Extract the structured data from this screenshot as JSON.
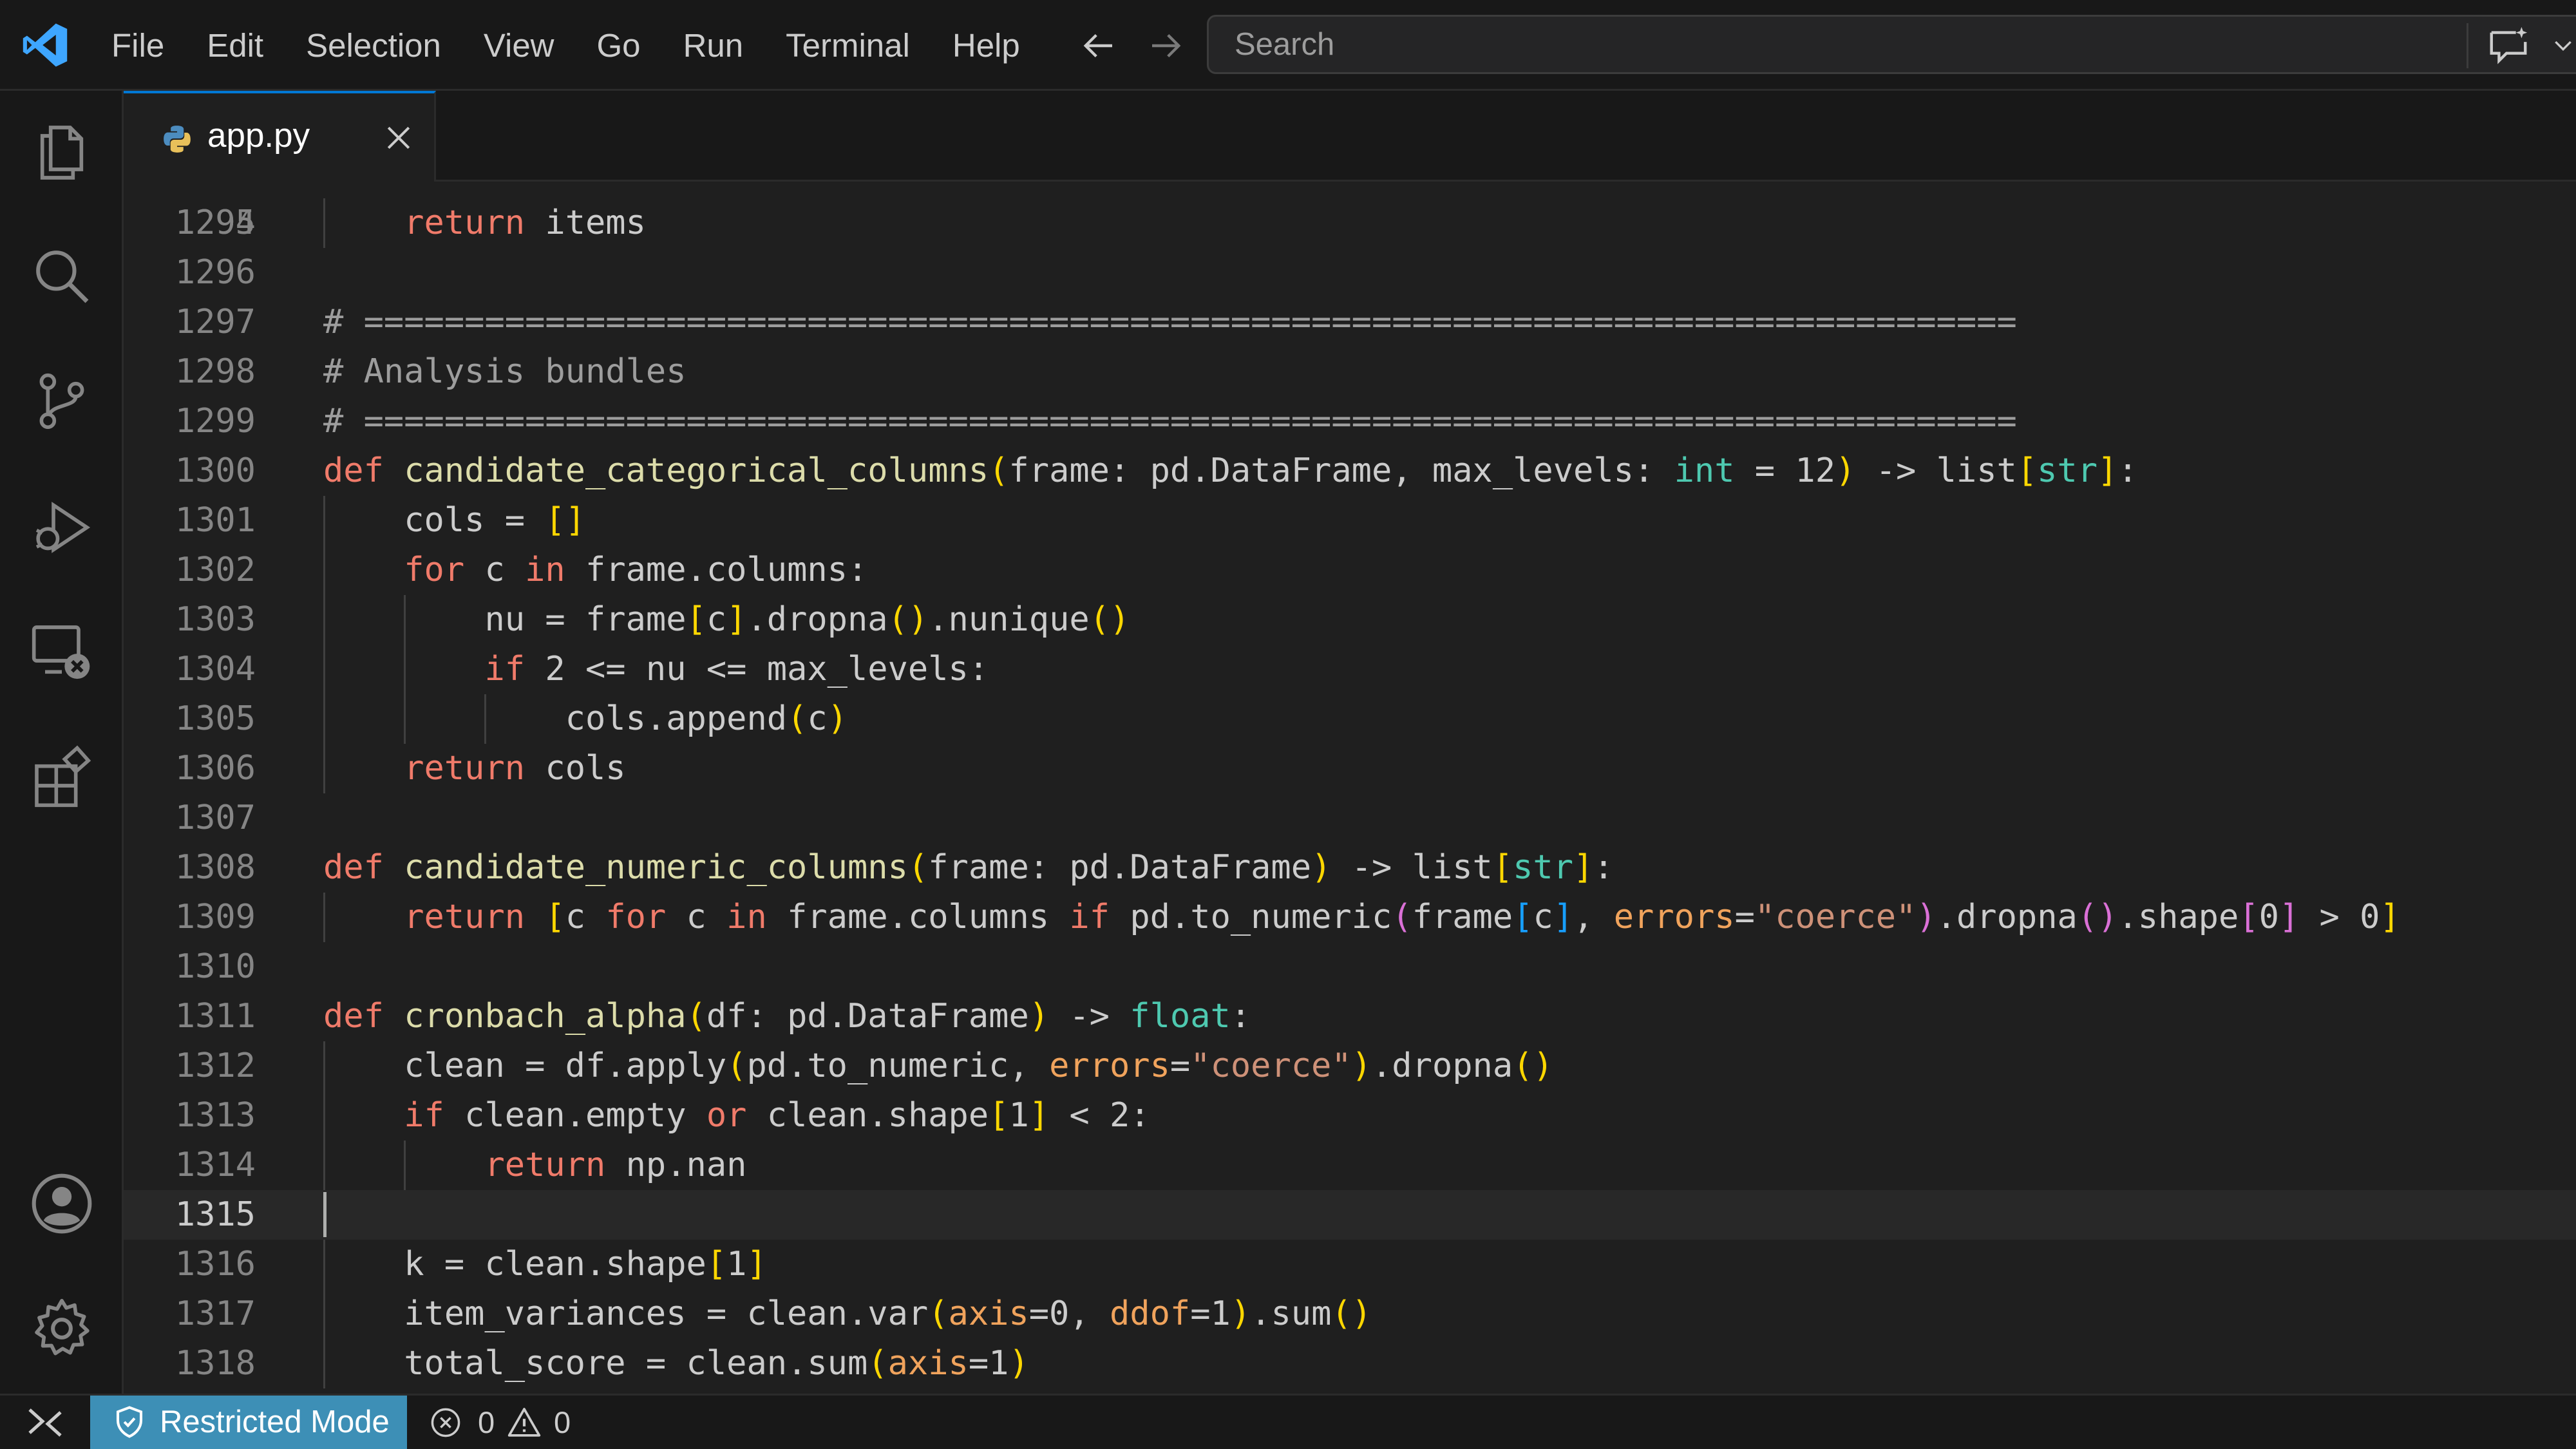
{
  "menu": [
    "File",
    "Edit",
    "Selection",
    "View",
    "Go",
    "Run",
    "Terminal",
    "Help"
  ],
  "search": {
    "placeholder": "Search"
  },
  "tab": {
    "label": "app.py"
  },
  "editor": {
    "current_line": "1315",
    "partial_top_line": "1294",
    "lines": [
      {
        "n": "1295"
      },
      {
        "n": "1296"
      },
      {
        "n": "1297"
      },
      {
        "n": "1298"
      },
      {
        "n": "1299"
      },
      {
        "n": "1300"
      },
      {
        "n": "1301"
      },
      {
        "n": "1302"
      },
      {
        "n": "1303"
      },
      {
        "n": "1304"
      },
      {
        "n": "1305"
      },
      {
        "n": "1306"
      },
      {
        "n": "1307"
      },
      {
        "n": "1308"
      },
      {
        "n": "1309"
      },
      {
        "n": "1310"
      },
      {
        "n": "1311"
      },
      {
        "n": "1312"
      },
      {
        "n": "1313"
      },
      {
        "n": "1314"
      },
      {
        "n": "1315"
      },
      {
        "n": "1316"
      },
      {
        "n": "1317"
      },
      {
        "n": "1318"
      }
    ],
    "code": {
      "1295": "    return items",
      "1297": "# ==================================================================================",
      "1298": "# Analysis bundles",
      "1299": "# ==================================================================================",
      "1300": "def candidate_categorical_columns(frame: pd.DataFrame, max_levels: int = 12) -> list[str]:",
      "1301": "    cols = []",
      "1302": "    for c in frame.columns:",
      "1303": "        nu = frame[c].dropna().nunique()",
      "1304": "        if 2 <= nu <= max_levels:",
      "1305": "            cols.append(c)",
      "1306": "    return cols",
      "1308": "def candidate_numeric_columns(frame: pd.DataFrame) -> list[str]:",
      "1309": "    return [c for c in frame.columns if pd.to_numeric(frame[c], errors=\"coerce\").dropna().shape[0] > 0]",
      "1311": "def cronbach_alpha(df: pd.DataFrame) -> float:",
      "1312": "    clean = df.apply(pd.to_numeric, errors=\"coerce\").dropna()",
      "1313": "    if clean.empty or clean.shape[1] < 2:",
      "1314": "        return np.nan",
      "1316": "    k = clean.shape[1]",
      "1317": "    item_variances = clean.var(axis=0, ddof=1).sum()",
      "1318": "    total_score = clean.sum(axis=1)"
    }
  },
  "status": {
    "restricted_label": "Restricted Mode",
    "errors": "0",
    "warnings": "0"
  },
  "icons": {
    "logo": "vscode-logo-icon",
    "activity": [
      "explorer-icon",
      "search-icon",
      "source-control-icon",
      "run-debug-icon",
      "remote-explorer-icon",
      "extensions-icon",
      "account-icon",
      "settings-gear-icon"
    ]
  },
  "colors": {
    "accent": "#0078d4",
    "restricted_bg": "#3d8fb6"
  }
}
